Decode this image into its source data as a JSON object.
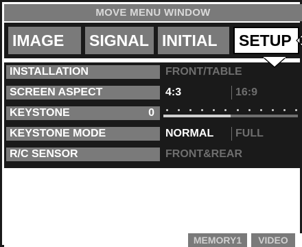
{
  "window": {
    "title": "MOVE MENU WINDOW"
  },
  "tabs": [
    {
      "label": "IMAGE",
      "active": false
    },
    {
      "label": "SIGNAL",
      "active": false
    },
    {
      "label": "INITIAL",
      "active": false
    },
    {
      "label": "SETUP",
      "active": true,
      "icon": "move-arrows-icon"
    }
  ],
  "menu": {
    "installation": {
      "label": "INSTALLATION",
      "value": "FRONT/TABLE"
    },
    "screen_aspect": {
      "label": "SCREEN ASPECT",
      "options": [
        "4:3",
        "16:9"
      ],
      "selected": "4:3"
    },
    "keystone": {
      "label": "KEYSTONE",
      "value": "0",
      "level": 0.5
    },
    "keystone_mode": {
      "label": "KEYSTONE MODE",
      "options": [
        "NORMAL",
        "FULL"
      ],
      "selected": "NORMAL"
    },
    "rc_sensor": {
      "label": "R/C SENSOR",
      "value": "FRONT&REAR"
    }
  },
  "status": {
    "memory": "MEMORY1",
    "source": "VIDEO"
  },
  "colors": {
    "frame": "#1a1a1a",
    "gray": "#7a7a7a",
    "dim_text": "#6e6e6e",
    "bright_text": "#ffffff"
  }
}
